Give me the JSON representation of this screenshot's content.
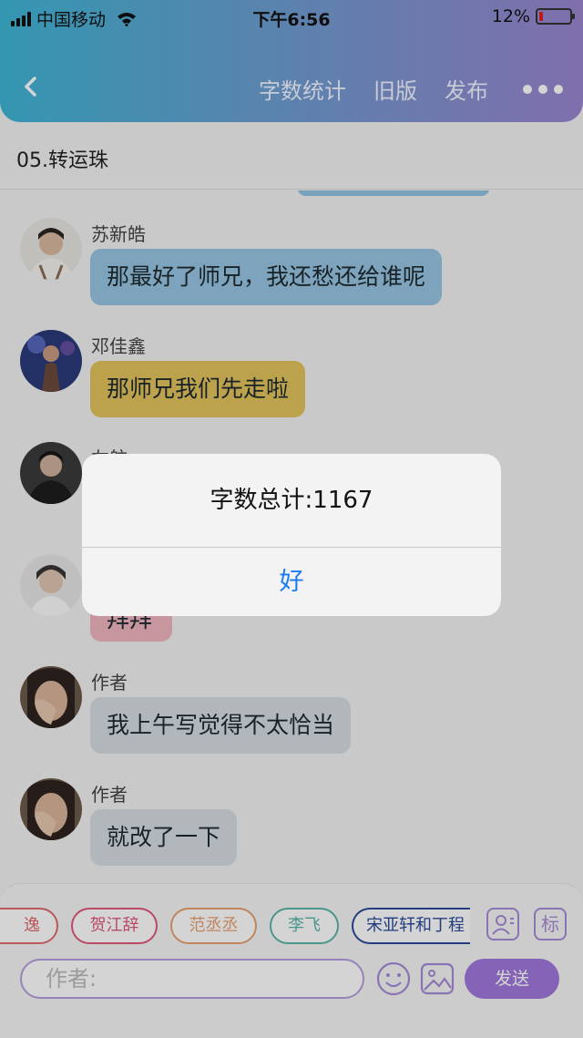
{
  "status_bar": {
    "carrier": "中国移动",
    "time": "下午6:56",
    "battery": "12%",
    "battery_level": 0.12
  },
  "nav": {
    "back_icon": "chevron-left-icon",
    "word_count_label": "字数统计",
    "old_version_label": "旧版",
    "publish_label": "发布",
    "more_icon": "more-dots-icon"
  },
  "chapter_title": "05.转运珠",
  "messages": [
    {
      "name": "苏新皓",
      "text": "那最好了师兄，我还愁还给谁呢",
      "bubble_color": "#97c6e2"
    },
    {
      "name": "邓佳鑫",
      "text": "那师兄我们先走啦",
      "bubble_color": "#e3c35c"
    },
    {
      "name": "左航",
      "text": "",
      "bubble_color": "#d6d6d6"
    },
    {
      "name": "",
      "text": "拜拜",
      "bubble_color": "#f1b5bf"
    },
    {
      "name": "作者",
      "text": "我上午写觉得不太恰当",
      "bubble_color": "#d7dde2"
    },
    {
      "name": "作者",
      "text": "就改了一下",
      "bubble_color": "#d7dde2"
    }
  ],
  "character_tags": [
    {
      "label": "逸",
      "color": "#e06b6b"
    },
    {
      "label": "贺江辞",
      "color": "#e0587a"
    },
    {
      "label": "范丞丞",
      "color": "#e8a070"
    },
    {
      "label": "李飞",
      "color": "#5ab5a8"
    },
    {
      "label": "宋亚轩和丁程",
      "color": "#2b4a9a"
    }
  ],
  "composer": {
    "placeholder": "作者:",
    "send_label": "发送",
    "mark_label": "标",
    "emoji_icon": "emoji-icon",
    "image_icon": "image-icon",
    "contact_icon": "contact-icon"
  },
  "dialog": {
    "message": "字数总计:1167",
    "ok_label": "好"
  },
  "colors": {
    "header_gradient_start": "#3fb6d6",
    "header_gradient_end": "#9a86d0",
    "accent_purple": "#a078db",
    "dialog_button": "#1b7cf2"
  }
}
